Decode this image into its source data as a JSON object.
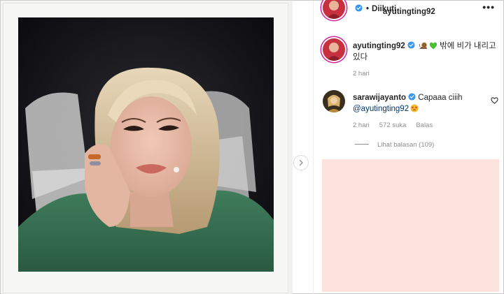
{
  "header": {
    "username": "ayutingting92",
    "separator": "•",
    "follow_label": "Diikuti",
    "more_label": "•••"
  },
  "caption": {
    "username": "ayutingting92",
    "text": "밖에 비가 내리고 있다",
    "emojis": [
      "snail-emoji",
      "green-heart-emoji"
    ],
    "time": "2 hari"
  },
  "comment": {
    "username": "sarawijayanto",
    "text": "Capaaa ciiih",
    "mention": "@ayutingting92",
    "emoji": "star-struck-emoji",
    "time": "2 hari",
    "likes": "572 suka",
    "reply_label": "Balas",
    "view_replies": "Lihat balasan (109)"
  },
  "colors": {
    "accent_link": "#00376b",
    "verified_blue": "#3897f0",
    "muted_text": "#8e8e8e",
    "ad_placeholder": "#fde3dd"
  },
  "icons": {
    "next": "chevron-right-icon",
    "like": "heart-outline-icon",
    "verified": "verified-badge-icon"
  }
}
